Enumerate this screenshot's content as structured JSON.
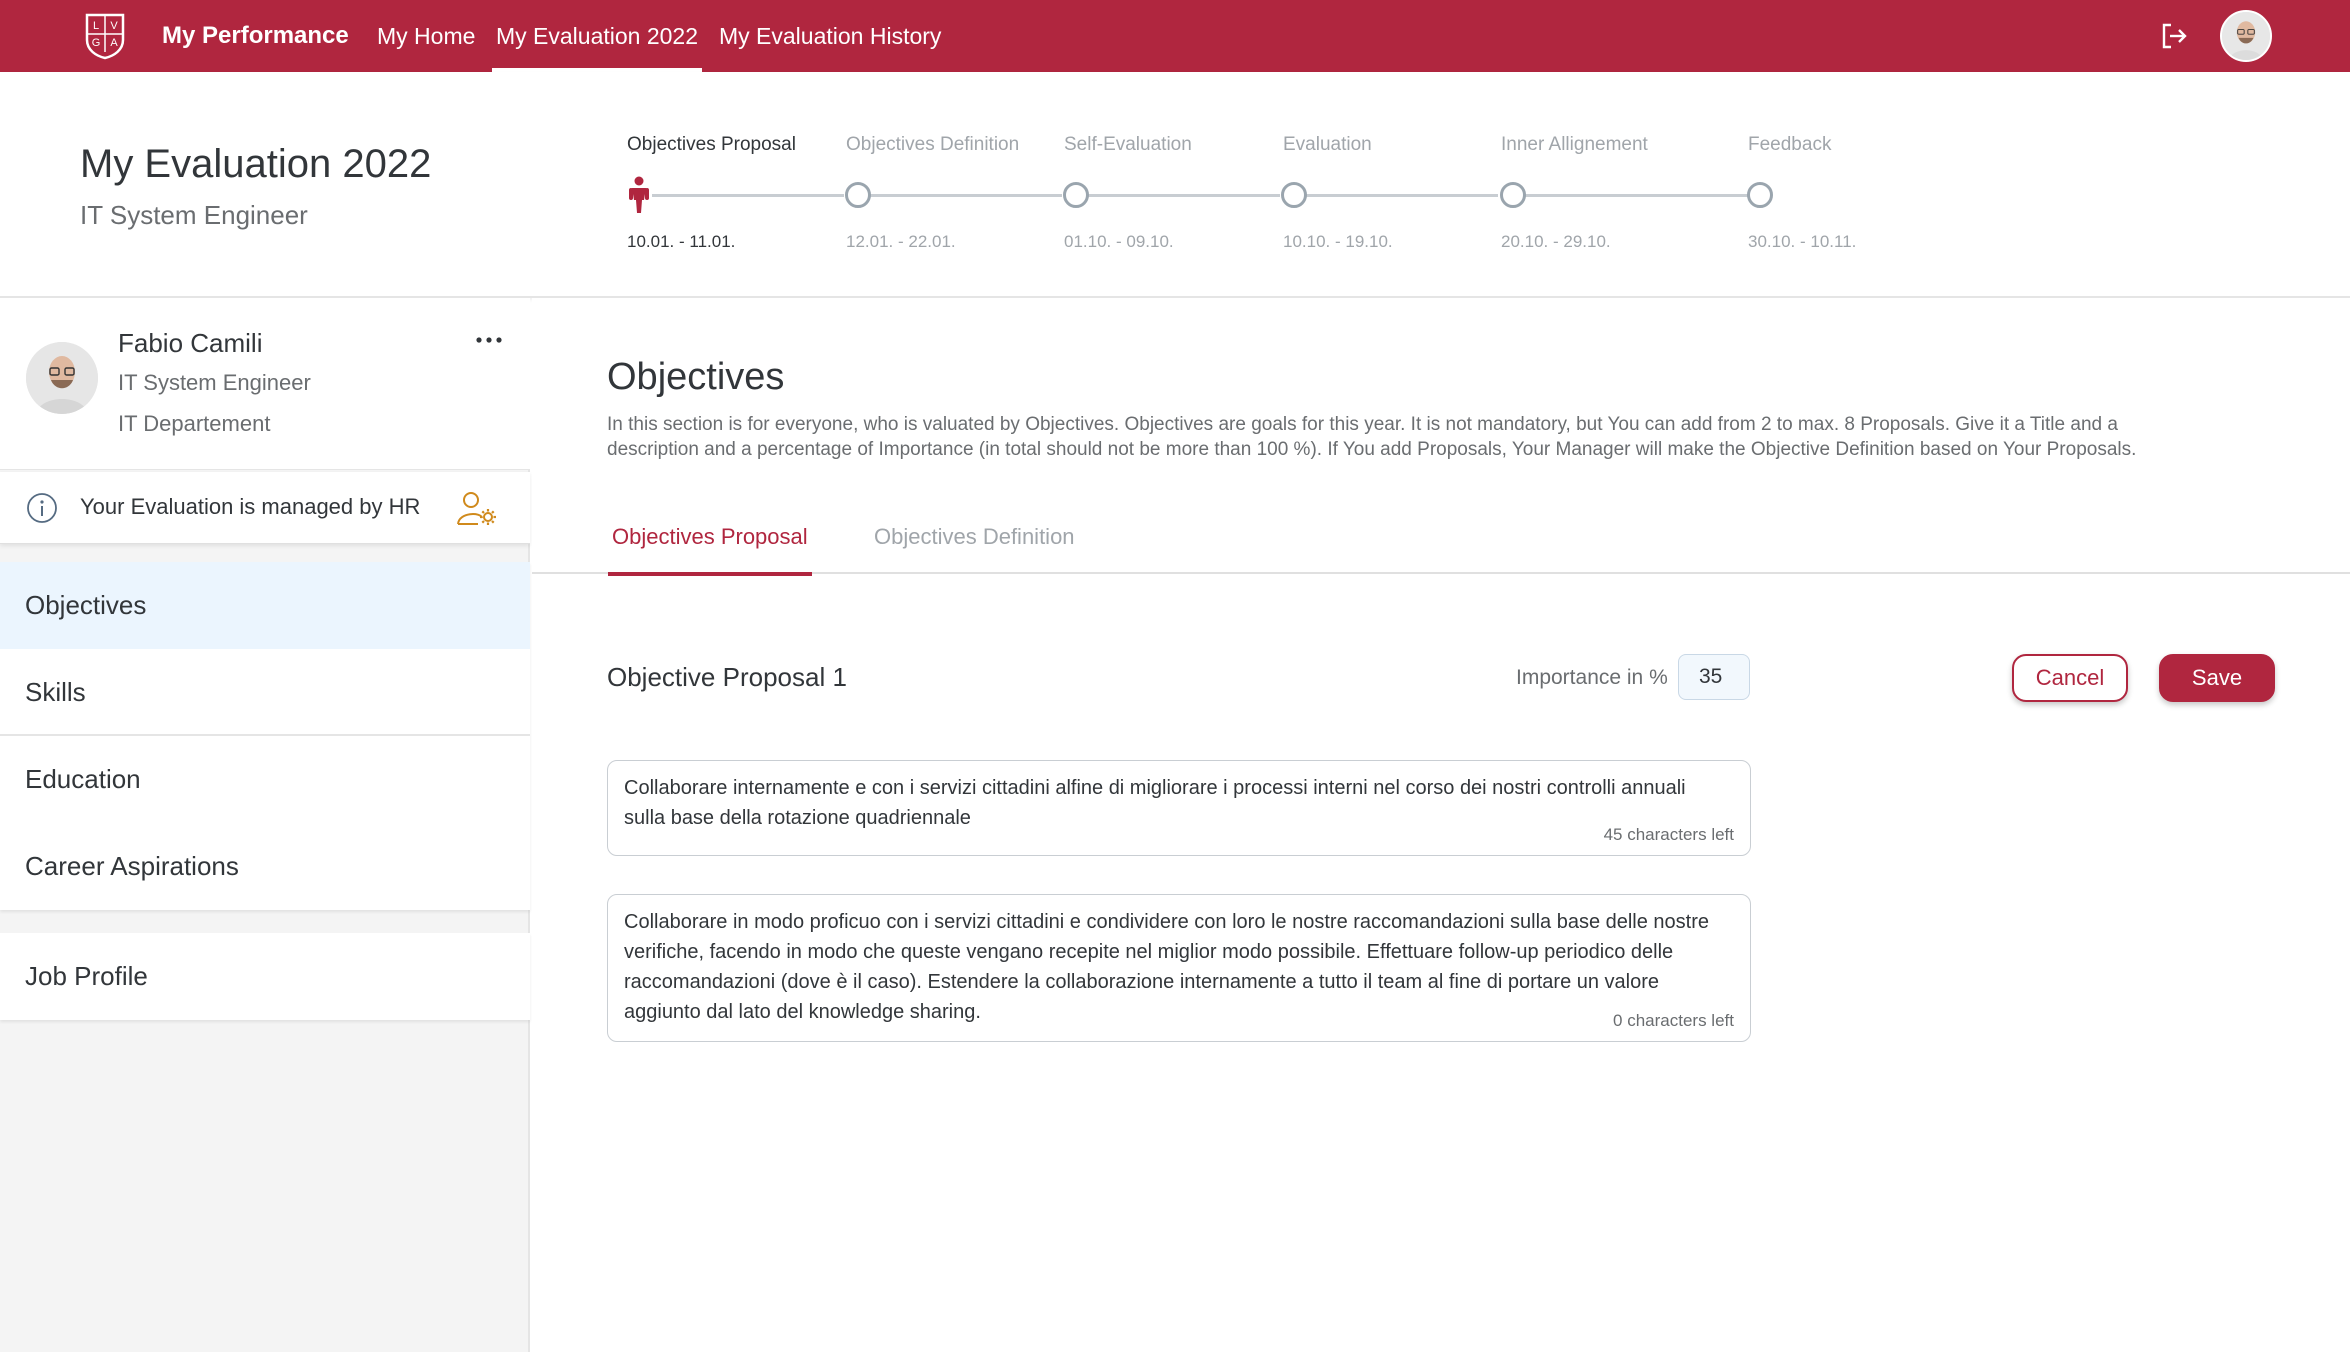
{
  "app": {
    "title": "My Performance",
    "logo_letters": "LVGA",
    "brand_color": "#b0263f"
  },
  "nav": {
    "items": [
      {
        "label": "My Home",
        "active": false
      },
      {
        "label": "My Evaluation 2022",
        "active": true
      },
      {
        "label": "My Evaluation History",
        "active": false
      }
    ],
    "logout_icon": "logout-icon"
  },
  "header": {
    "title": "My Evaluation 2022",
    "subtitle": "IT System Engineer",
    "steps": [
      {
        "label": "Objectives Proposal",
        "dates": "10.01. - 11.01.",
        "current": true
      },
      {
        "label": "Objectives Definition",
        "dates": "12.01. - 22.01.",
        "current": false
      },
      {
        "label": "Self-Evaluation",
        "dates": "01.10. - 09.10.",
        "current": false
      },
      {
        "label": "Evaluation",
        "dates": "10.10. - 19.10.",
        "current": false
      },
      {
        "label": "Inner Allignement",
        "dates": "20.10. - 29.10.",
        "current": false
      },
      {
        "label": "Feedback",
        "dates": "30.10. - 10.11.",
        "current": false
      }
    ]
  },
  "profile": {
    "name": "Fabio Camili",
    "role": "IT System Engineer",
    "department": "IT Departement",
    "hr_notice": "Your Evaluation is managed by HR"
  },
  "sidebar": {
    "items": [
      {
        "label": "Objectives",
        "selected": true
      },
      {
        "label": "Skills",
        "selected": false
      },
      {
        "label": "Education",
        "selected": false
      },
      {
        "label": "Career Aspirations",
        "selected": false
      },
      {
        "label": "Job Profile",
        "selected": false
      }
    ]
  },
  "main": {
    "title": "Objectives",
    "description": "In this section is for everyone, who is valuated by Objectives. Objectives are goals for this year. It is not mandatory, but You can add from 2 to max. 8 Proposals. Give it a Title and a description and a percentage of Importance (in total should not be more than 100 %). If You add Proposals, Your Manager will make the Objective Definition based on Your Proposals.",
    "tabs": [
      {
        "label": "Objectives Proposal",
        "active": true
      },
      {
        "label": "Objectives Definition",
        "active": false
      }
    ],
    "proposal": {
      "title": "Objective Proposal 1",
      "importance_label": "Importance in %",
      "importance_value": "35",
      "cancel_label": "Cancel",
      "save_label": "Save",
      "fields": [
        {
          "text": "Collaborare internamente e con i servizi cittadini alfine di migliorare i processi interni nel corso dei nostri controlli annuali sulla base della rotazione quadriennale",
          "counter": "45 characters left"
        },
        {
          "text": "Collaborare in modo proficuo con i servizi cittadini e condividere con loro le nostre raccomandazioni sulla base delle nostre verifiche, facendo in modo che queste vengano recepite nel miglior modo possibile. Effettuare follow-up periodico delle raccomandazioni (dove è il caso). Estendere la collaborazione internamente a tutto il team al fine di portare un valore aggiunto dal lato del knowledge sharing.",
          "counter": "0 characters left"
        }
      ]
    }
  }
}
